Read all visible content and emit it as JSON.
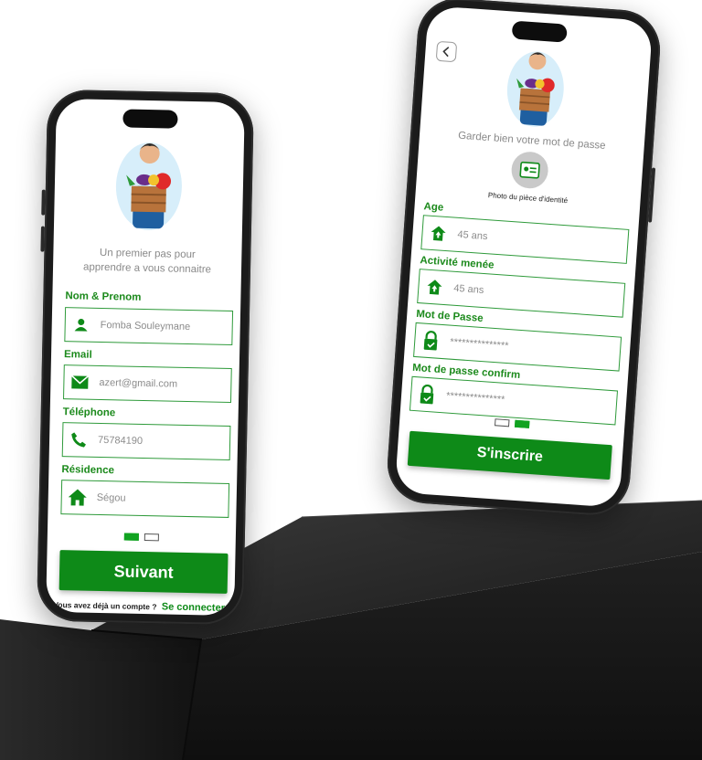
{
  "signup_step1": {
    "subtitle_line1": "Un premier pas pour",
    "subtitle_line2": "apprendre a vous connaitre",
    "fields": [
      {
        "label": "Nom & Prenom",
        "value": "Fomba Souleymane",
        "icon": "person-icon"
      },
      {
        "label": "Email",
        "value": "azert@gmail.com",
        "icon": "mail-icon"
      },
      {
        "label": "Téléphone",
        "value": "75784190",
        "icon": "phone-icon"
      },
      {
        "label": "Résidence",
        "value": "Ségou",
        "icon": "home-icon"
      }
    ],
    "next_label": "Suivant",
    "account_prompt": "Vous avez déjà un compte ?",
    "login_link": "Se connecter",
    "step_active": 1
  },
  "signup_step2": {
    "subtitle": "Garder bien votre mot de passe",
    "id_photo_label": "Photo du pièce d'identité",
    "fields": [
      {
        "label": "Age",
        "value": "45 ans",
        "icon": "home-up-icon"
      },
      {
        "label": "Activité menée",
        "value": "45 ans",
        "icon": "home-up-icon"
      },
      {
        "label": "Mot de Passe",
        "value": "***************",
        "icon": "lock-check-icon"
      },
      {
        "label": "Mot de passe confirm",
        "value": "***************",
        "icon": "lock-check-icon"
      }
    ],
    "submit_label": "S'inscrire",
    "back_icon": "chevron-left-icon",
    "step_active": 2
  },
  "colors": {
    "accent": "#0e8a18",
    "label": "#1c8a1c",
    "pedestal": "#1e1e1e"
  }
}
